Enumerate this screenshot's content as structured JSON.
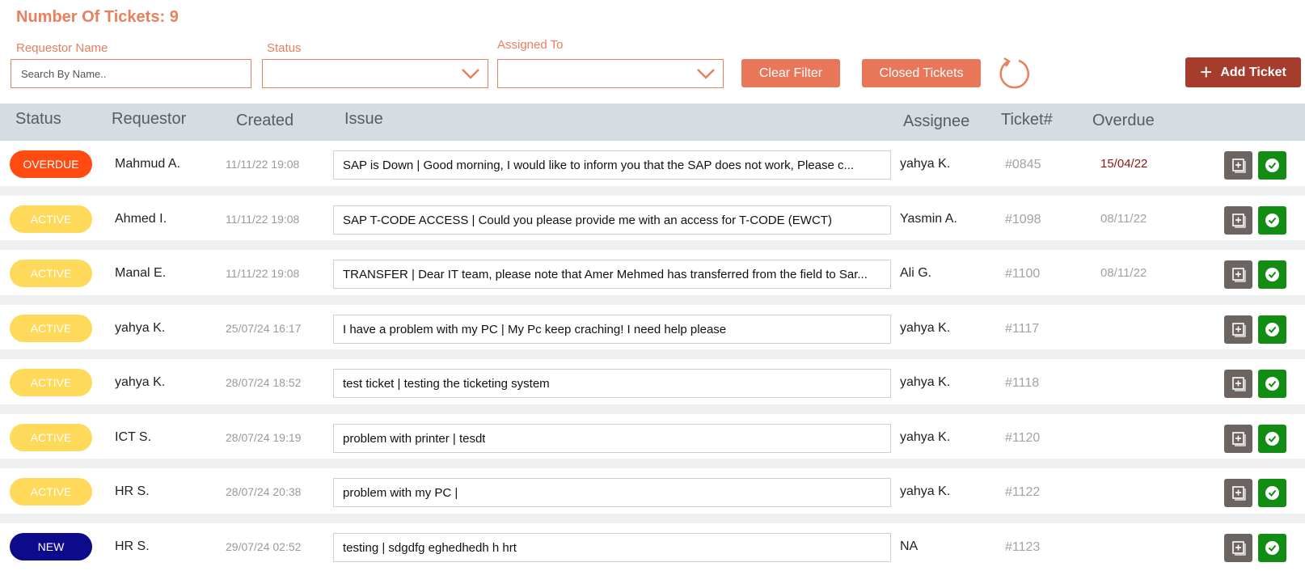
{
  "header": {
    "title_prefix": "Number Of Tickets:",
    "ticket_count": "9"
  },
  "filters": {
    "requestor_label": "Requestor Name",
    "requestor_placeholder": "Search By Name..",
    "status_label": "Status",
    "status_value": "",
    "assigned_label": "Assigned To",
    "assigned_value": ""
  },
  "toolbar": {
    "clear_filter": "Clear Filter",
    "closed_tickets": "Closed Tickets",
    "add_ticket": "Add Ticket",
    "refresh_icon": "refresh-icon",
    "plus_icon": "plus-icon"
  },
  "columns": {
    "status": "Status",
    "requestor": "Requestor",
    "created": "Created",
    "issue": "Issue",
    "assignee": "Assignee",
    "ticket": "Ticket#",
    "overdue": "Overdue"
  },
  "colors": {
    "accent": "#e8805e",
    "add_button": "#a63d2c",
    "overdue_badge": "#ff4a12",
    "active_badge": "#ffd95a",
    "new_badge": "#0b0b8c",
    "edit_button": "#6b6461",
    "complete_button": "#138c13"
  },
  "tickets": [
    {
      "status": "OVERDUE",
      "status_type": "overdue",
      "requestor": "Mahmud A.",
      "created": "11/11/22 19:08",
      "issue": "SAP is Down  | Good morning, I would like to inform you that the SAP does not work, Please c...",
      "assignee": "yahya K.",
      "ticket": "#0845",
      "overdue": "15/04/22",
      "overdue_red": true
    },
    {
      "status": "ACTIVE",
      "status_type": "active",
      "requestor": "Ahmed I.",
      "created": "11/11/22 19:08",
      "issue": "SAP T-CODE ACCESS | Could you please provide me with an access for T-CODE (EWCT)",
      "assignee": "Yasmin A.",
      "ticket": "#1098",
      "overdue": "08/11/22",
      "overdue_red": false
    },
    {
      "status": "ACTIVE",
      "status_type": "active",
      "requestor": "Manal E.",
      "created": "11/11/22 19:08",
      "issue": "TRANSFER | Dear IT team, please note that Amer Mehmed has transferred from the field to Sar...",
      "assignee": "Ali G.",
      "ticket": "#1100",
      "overdue": "08/11/22",
      "overdue_red": false
    },
    {
      "status": "ACTIVE",
      "status_type": "active",
      "requestor": "yahya K.",
      "created": "25/07/24 16:17",
      "issue": "I have a problem with my PC | My Pc keep craching! I need help please",
      "assignee": "yahya K.",
      "ticket": "#1117",
      "overdue": "",
      "overdue_red": false
    },
    {
      "status": "ACTIVE",
      "status_type": "active",
      "requestor": "yahya K.",
      "created": "28/07/24 18:52",
      "issue": "test ticket | testing the ticketing system",
      "assignee": "yahya K.",
      "ticket": "#1118",
      "overdue": "",
      "overdue_red": false
    },
    {
      "status": "ACTIVE",
      "status_type": "active",
      "requestor": "ICT S.",
      "created": "28/07/24 19:19",
      "issue": "problem with printer | tesdt",
      "assignee": "yahya K.",
      "ticket": "#1120",
      "overdue": "",
      "overdue_red": false
    },
    {
      "status": "ACTIVE",
      "status_type": "active",
      "requestor": "HR S.",
      "created": "28/07/24 20:38",
      "issue": "problem with my PC |",
      "assignee": "yahya K.",
      "ticket": "#1122",
      "overdue": "",
      "overdue_red": false
    },
    {
      "status": "NEW",
      "status_type": "new",
      "requestor": "HR S.",
      "created": "29/07/24 02:52",
      "issue": "testing | sdgdfg eghedhedh h hrt",
      "assignee": "NA",
      "ticket": "#1123",
      "overdue": "",
      "overdue_red": false
    }
  ]
}
